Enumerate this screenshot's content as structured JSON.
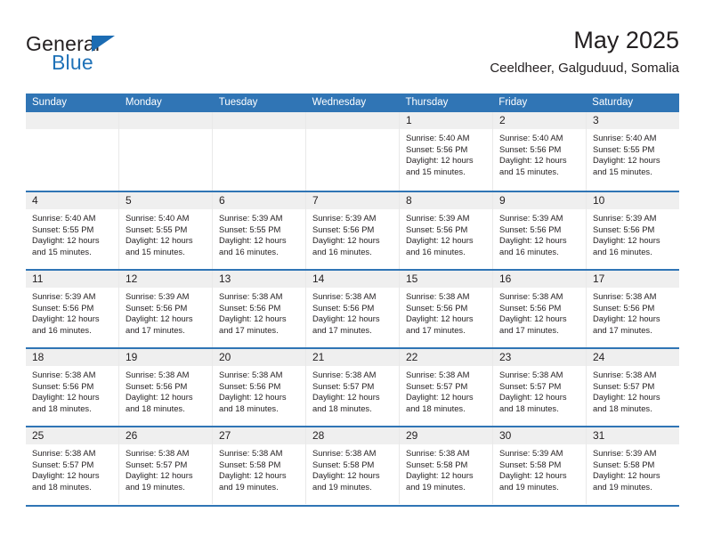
{
  "brand": {
    "line1": "General",
    "line2": "Blue",
    "accent_color": "#1b6cb3"
  },
  "header": {
    "title": "May 2025",
    "subtitle": "Ceeldheer, Galguduud, Somalia"
  },
  "theme": {
    "header_blue": "#3075b5",
    "daynum_band": "#efefef",
    "text": "#231f20"
  },
  "weekdays": [
    "Sunday",
    "Monday",
    "Tuesday",
    "Wednesday",
    "Thursday",
    "Friday",
    "Saturday"
  ],
  "weeks": [
    [
      {
        "day": "",
        "sunrise": "",
        "sunset": "",
        "daylight1": "",
        "daylight2": ""
      },
      {
        "day": "",
        "sunrise": "",
        "sunset": "",
        "daylight1": "",
        "daylight2": ""
      },
      {
        "day": "",
        "sunrise": "",
        "sunset": "",
        "daylight1": "",
        "daylight2": ""
      },
      {
        "day": "",
        "sunrise": "",
        "sunset": "",
        "daylight1": "",
        "daylight2": ""
      },
      {
        "day": "1",
        "sunrise": "Sunrise: 5:40 AM",
        "sunset": "Sunset: 5:56 PM",
        "daylight1": "Daylight: 12 hours",
        "daylight2": "and 15 minutes."
      },
      {
        "day": "2",
        "sunrise": "Sunrise: 5:40 AM",
        "sunset": "Sunset: 5:56 PM",
        "daylight1": "Daylight: 12 hours",
        "daylight2": "and 15 minutes."
      },
      {
        "day": "3",
        "sunrise": "Sunrise: 5:40 AM",
        "sunset": "Sunset: 5:55 PM",
        "daylight1": "Daylight: 12 hours",
        "daylight2": "and 15 minutes."
      }
    ],
    [
      {
        "day": "4",
        "sunrise": "Sunrise: 5:40 AM",
        "sunset": "Sunset: 5:55 PM",
        "daylight1": "Daylight: 12 hours",
        "daylight2": "and 15 minutes."
      },
      {
        "day": "5",
        "sunrise": "Sunrise: 5:40 AM",
        "sunset": "Sunset: 5:55 PM",
        "daylight1": "Daylight: 12 hours",
        "daylight2": "and 15 minutes."
      },
      {
        "day": "6",
        "sunrise": "Sunrise: 5:39 AM",
        "sunset": "Sunset: 5:55 PM",
        "daylight1": "Daylight: 12 hours",
        "daylight2": "and 16 minutes."
      },
      {
        "day": "7",
        "sunrise": "Sunrise: 5:39 AM",
        "sunset": "Sunset: 5:56 PM",
        "daylight1": "Daylight: 12 hours",
        "daylight2": "and 16 minutes."
      },
      {
        "day": "8",
        "sunrise": "Sunrise: 5:39 AM",
        "sunset": "Sunset: 5:56 PM",
        "daylight1": "Daylight: 12 hours",
        "daylight2": "and 16 minutes."
      },
      {
        "day": "9",
        "sunrise": "Sunrise: 5:39 AM",
        "sunset": "Sunset: 5:56 PM",
        "daylight1": "Daylight: 12 hours",
        "daylight2": "and 16 minutes."
      },
      {
        "day": "10",
        "sunrise": "Sunrise: 5:39 AM",
        "sunset": "Sunset: 5:56 PM",
        "daylight1": "Daylight: 12 hours",
        "daylight2": "and 16 minutes."
      }
    ],
    [
      {
        "day": "11",
        "sunrise": "Sunrise: 5:39 AM",
        "sunset": "Sunset: 5:56 PM",
        "daylight1": "Daylight: 12 hours",
        "daylight2": "and 16 minutes."
      },
      {
        "day": "12",
        "sunrise": "Sunrise: 5:39 AM",
        "sunset": "Sunset: 5:56 PM",
        "daylight1": "Daylight: 12 hours",
        "daylight2": "and 17 minutes."
      },
      {
        "day": "13",
        "sunrise": "Sunrise: 5:38 AM",
        "sunset": "Sunset: 5:56 PM",
        "daylight1": "Daylight: 12 hours",
        "daylight2": "and 17 minutes."
      },
      {
        "day": "14",
        "sunrise": "Sunrise: 5:38 AM",
        "sunset": "Sunset: 5:56 PM",
        "daylight1": "Daylight: 12 hours",
        "daylight2": "and 17 minutes."
      },
      {
        "day": "15",
        "sunrise": "Sunrise: 5:38 AM",
        "sunset": "Sunset: 5:56 PM",
        "daylight1": "Daylight: 12 hours",
        "daylight2": "and 17 minutes."
      },
      {
        "day": "16",
        "sunrise": "Sunrise: 5:38 AM",
        "sunset": "Sunset: 5:56 PM",
        "daylight1": "Daylight: 12 hours",
        "daylight2": "and 17 minutes."
      },
      {
        "day": "17",
        "sunrise": "Sunrise: 5:38 AM",
        "sunset": "Sunset: 5:56 PM",
        "daylight1": "Daylight: 12 hours",
        "daylight2": "and 17 minutes."
      }
    ],
    [
      {
        "day": "18",
        "sunrise": "Sunrise: 5:38 AM",
        "sunset": "Sunset: 5:56 PM",
        "daylight1": "Daylight: 12 hours",
        "daylight2": "and 18 minutes."
      },
      {
        "day": "19",
        "sunrise": "Sunrise: 5:38 AM",
        "sunset": "Sunset: 5:56 PM",
        "daylight1": "Daylight: 12 hours",
        "daylight2": "and 18 minutes."
      },
      {
        "day": "20",
        "sunrise": "Sunrise: 5:38 AM",
        "sunset": "Sunset: 5:56 PM",
        "daylight1": "Daylight: 12 hours",
        "daylight2": "and 18 minutes."
      },
      {
        "day": "21",
        "sunrise": "Sunrise: 5:38 AM",
        "sunset": "Sunset: 5:57 PM",
        "daylight1": "Daylight: 12 hours",
        "daylight2": "and 18 minutes."
      },
      {
        "day": "22",
        "sunrise": "Sunrise: 5:38 AM",
        "sunset": "Sunset: 5:57 PM",
        "daylight1": "Daylight: 12 hours",
        "daylight2": "and 18 minutes."
      },
      {
        "day": "23",
        "sunrise": "Sunrise: 5:38 AM",
        "sunset": "Sunset: 5:57 PM",
        "daylight1": "Daylight: 12 hours",
        "daylight2": "and 18 minutes."
      },
      {
        "day": "24",
        "sunrise": "Sunrise: 5:38 AM",
        "sunset": "Sunset: 5:57 PM",
        "daylight1": "Daylight: 12 hours",
        "daylight2": "and 18 minutes."
      }
    ],
    [
      {
        "day": "25",
        "sunrise": "Sunrise: 5:38 AM",
        "sunset": "Sunset: 5:57 PM",
        "daylight1": "Daylight: 12 hours",
        "daylight2": "and 18 minutes."
      },
      {
        "day": "26",
        "sunrise": "Sunrise: 5:38 AM",
        "sunset": "Sunset: 5:57 PM",
        "daylight1": "Daylight: 12 hours",
        "daylight2": "and 19 minutes."
      },
      {
        "day": "27",
        "sunrise": "Sunrise: 5:38 AM",
        "sunset": "Sunset: 5:58 PM",
        "daylight1": "Daylight: 12 hours",
        "daylight2": "and 19 minutes."
      },
      {
        "day": "28",
        "sunrise": "Sunrise: 5:38 AM",
        "sunset": "Sunset: 5:58 PM",
        "daylight1": "Daylight: 12 hours",
        "daylight2": "and 19 minutes."
      },
      {
        "day": "29",
        "sunrise": "Sunrise: 5:38 AM",
        "sunset": "Sunset: 5:58 PM",
        "daylight1": "Daylight: 12 hours",
        "daylight2": "and 19 minutes."
      },
      {
        "day": "30",
        "sunrise": "Sunrise: 5:39 AM",
        "sunset": "Sunset: 5:58 PM",
        "daylight1": "Daylight: 12 hours",
        "daylight2": "and 19 minutes."
      },
      {
        "day": "31",
        "sunrise": "Sunrise: 5:39 AM",
        "sunset": "Sunset: 5:58 PM",
        "daylight1": "Daylight: 12 hours",
        "daylight2": "and 19 minutes."
      }
    ]
  ]
}
